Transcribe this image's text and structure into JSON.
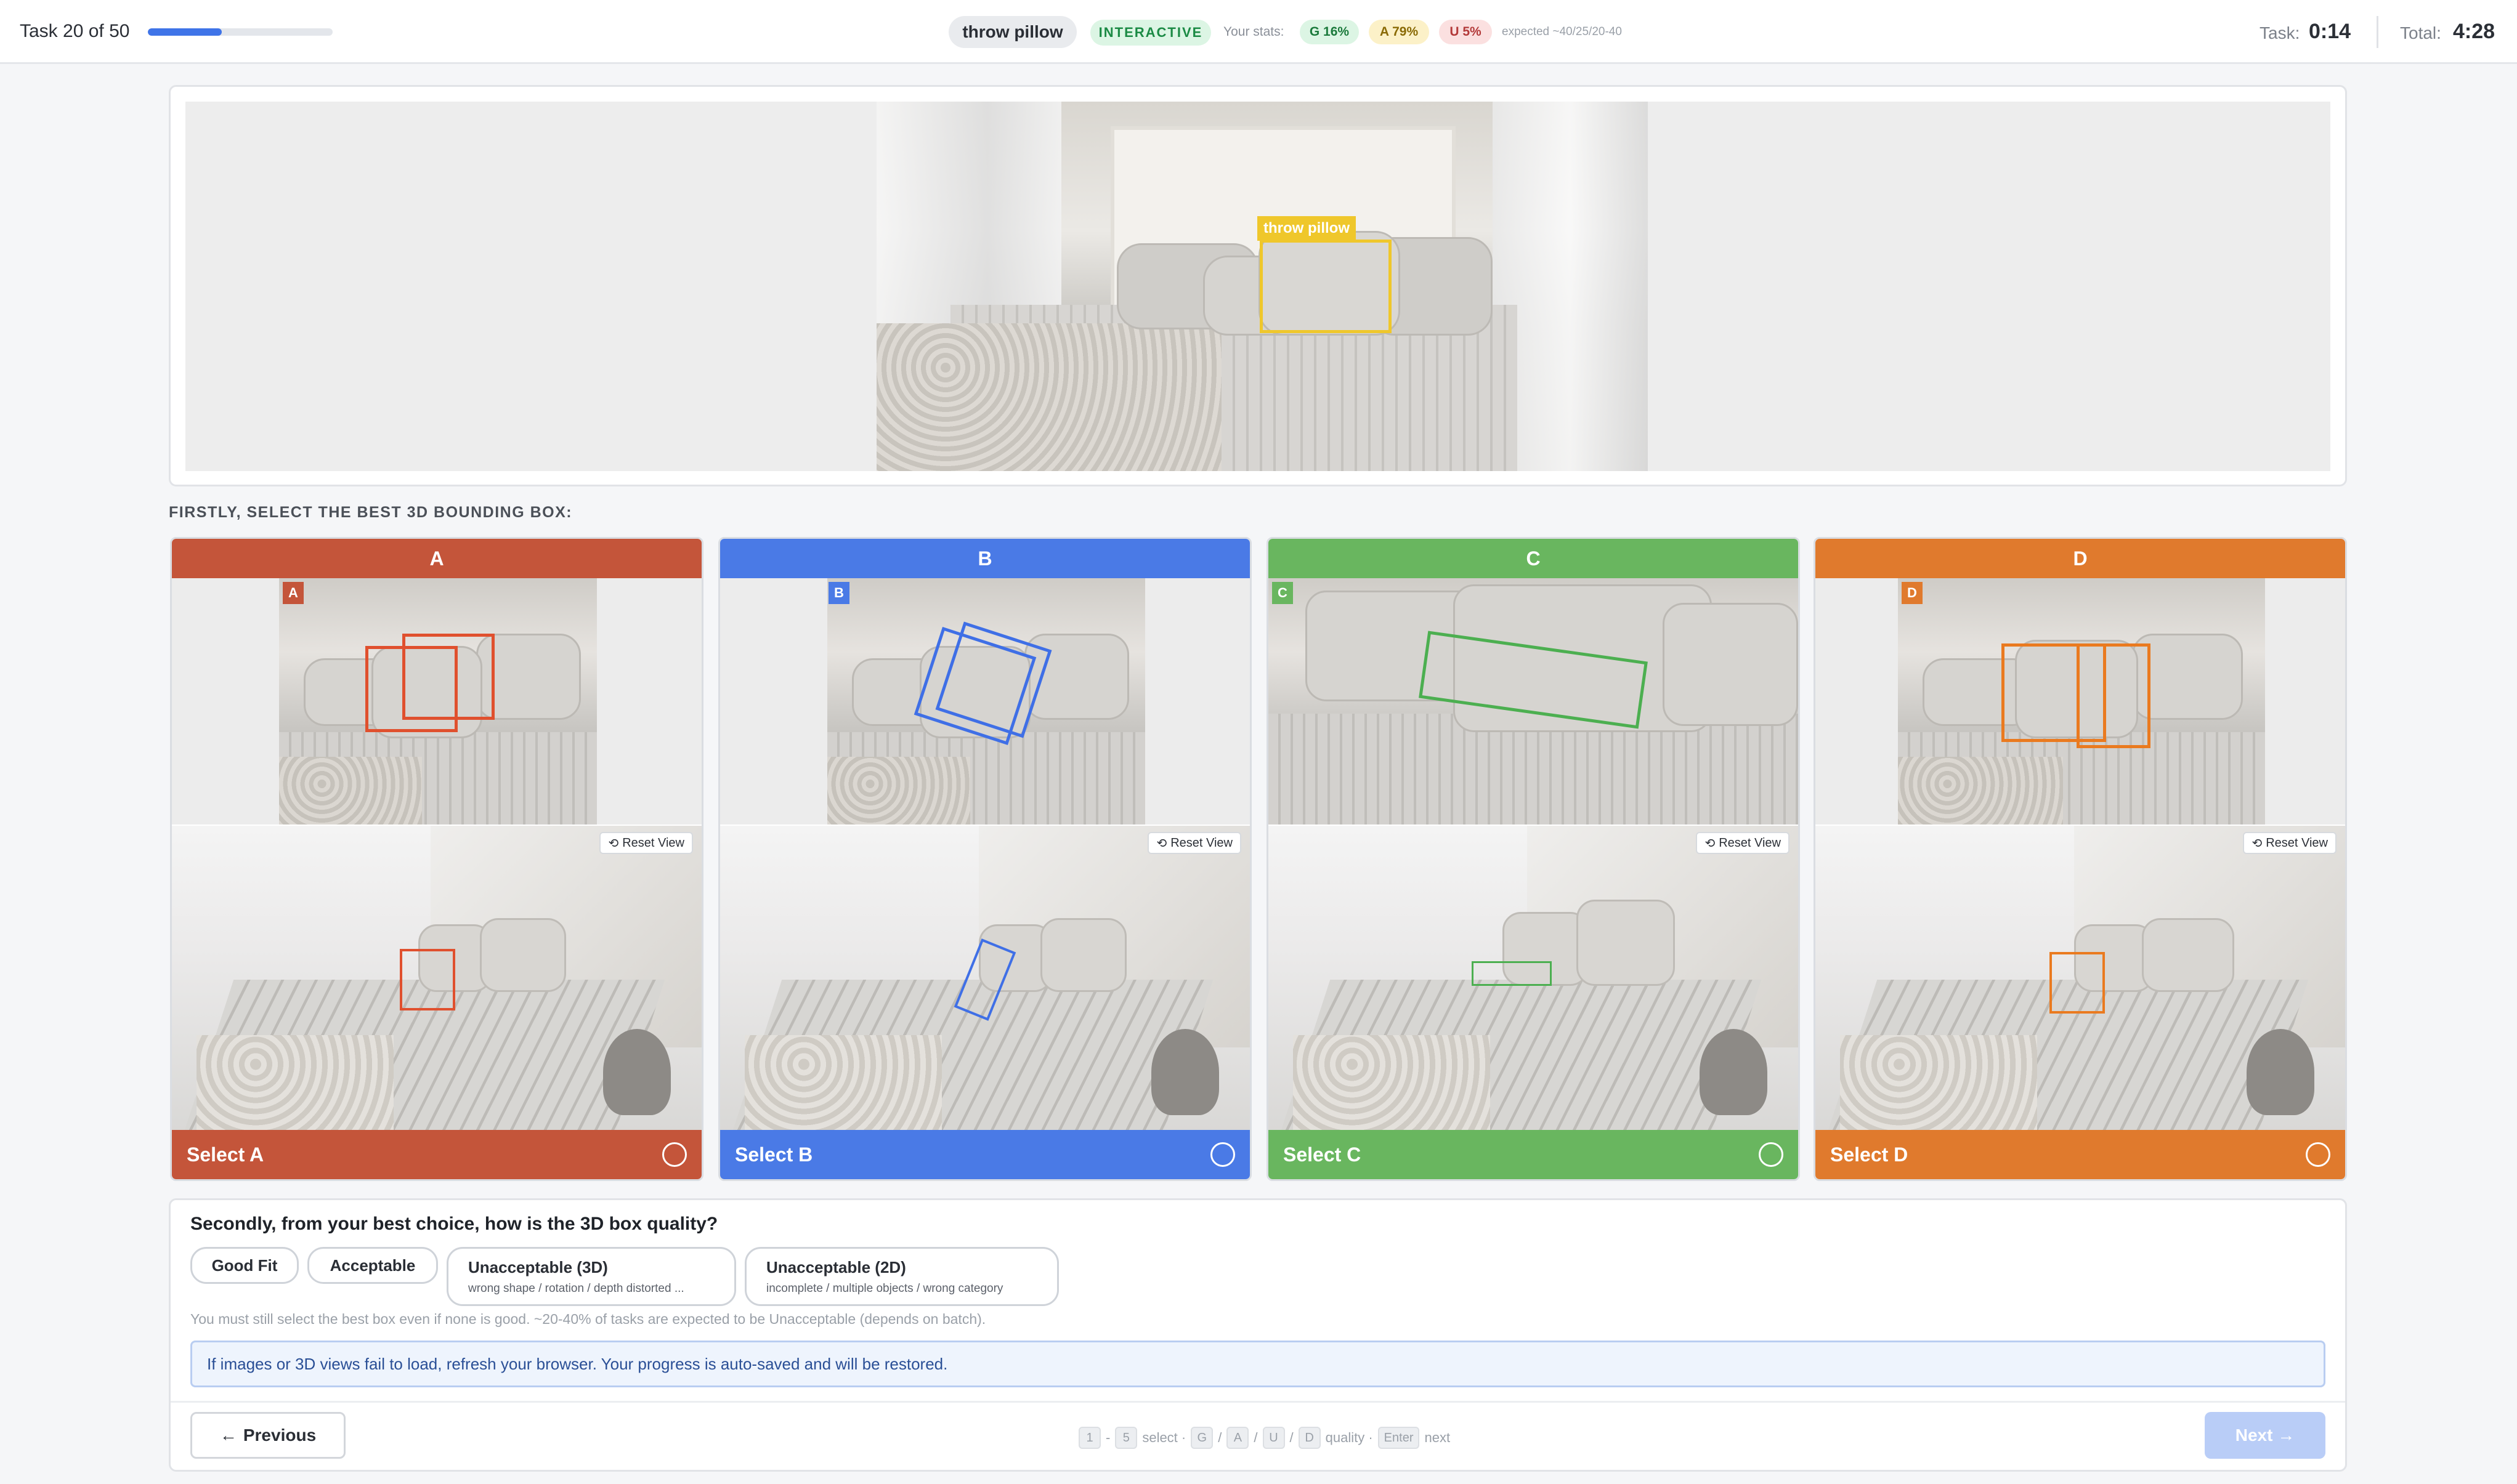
{
  "header": {
    "task_label": "Task 20 of 50",
    "progress_fraction": 0.4,
    "category": "throw pillow",
    "mode": "INTERACTIVE",
    "stats_label": "Your stats:",
    "stats": {
      "good": "G 16%",
      "acceptable": "A 79%",
      "unacceptable": "U 5%"
    },
    "stats_expected": "expected ~40/25/20-40",
    "timer": {
      "task_label": "Task:",
      "task_value": "0:14",
      "total_label": "Total:",
      "total_value": "4:28"
    }
  },
  "image": {
    "bbox_label": "throw pillow",
    "bbox_color": "#efc72b"
  },
  "section_heading": "FIRSTLY, SELECT THE BEST 3D BOUNDING BOX:",
  "options": [
    {
      "letter": "A",
      "select_label": "Select A",
      "color": "#c4553a",
      "reset_label": "Reset View"
    },
    {
      "letter": "B",
      "select_label": "Select B",
      "color": "#4a7ae6",
      "reset_label": "Reset View"
    },
    {
      "letter": "C",
      "select_label": "Select C",
      "color": "#69b65f",
      "reset_label": "Reset View"
    },
    {
      "letter": "D",
      "select_label": "Select D",
      "color": "#e07a2d",
      "reset_label": "Reset View"
    }
  ],
  "quality": {
    "question": "Secondly, from your best choice, how is the 3D box quality?",
    "good_fit": "Good Fit",
    "acceptable": "Acceptable",
    "unacceptable_3d": "Unacceptable (3D)",
    "unacceptable_3d_sub": "wrong shape / rotation / depth distorted ...",
    "unacceptable_2d": "Unacceptable (2D)",
    "unacceptable_2d_sub": "incomplete / multiple objects / wrong category",
    "note": "You must still select the best box even if none is good. ~20-40% of tasks are expected to be Unacceptable (depends on batch).",
    "notice": "If images or 3D views fail to load, refresh your browser. Your progress is auto-saved and will be restored."
  },
  "footer": {
    "previous_label": "Previous",
    "next_label": "Next →",
    "shortcuts": {
      "k1": "1",
      "dash": "-",
      "k5": "5",
      "select_text": "select ·",
      "kg": "G",
      "slash1": "/",
      "ka": "A",
      "slash2": "/",
      "ku": "U",
      "slash3": "/",
      "kd": "D",
      "quality_text": "quality ·",
      "kenter": "Enter",
      "next_text": "next"
    }
  }
}
